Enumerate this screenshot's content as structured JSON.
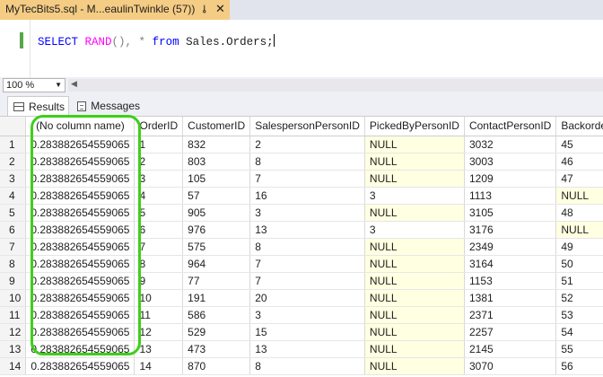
{
  "tab": {
    "title": "MyTecBits5.sql - M...eaulinTwinkle (57))",
    "pin": "⊸",
    "close": "✕"
  },
  "editor": {
    "kw_select": "SELECT",
    "fn_rand": "RAND",
    "rest1": "(), * ",
    "kw_from": "from",
    "rest2": " Sales.Orders;"
  },
  "zoom": {
    "value": "100 %"
  },
  "results_tabs": {
    "results": "Results",
    "messages": "Messages"
  },
  "grid": {
    "columns": [
      "(No column name)",
      "OrderID",
      "CustomerID",
      "SalespersonPersonID",
      "PickedByPersonID",
      "ContactPersonID",
      "BackorderOrd"
    ],
    "rows": [
      [
        "1",
        "0.283882654559065",
        "1",
        "832",
        "2",
        "NULL",
        "3032",
        "45"
      ],
      [
        "2",
        "0.283882654559065",
        "2",
        "803",
        "8",
        "NULL",
        "3003",
        "46"
      ],
      [
        "3",
        "0.283882654559065",
        "3",
        "105",
        "7",
        "NULL",
        "1209",
        "47"
      ],
      [
        "4",
        "0.283882654559065",
        "4",
        "57",
        "16",
        "3",
        "1113",
        "NULL"
      ],
      [
        "5",
        "0.283882654559065",
        "5",
        "905",
        "3",
        "NULL",
        "3105",
        "48"
      ],
      [
        "6",
        "0.283882654559065",
        "6",
        "976",
        "13",
        "3",
        "3176",
        "NULL"
      ],
      [
        "7",
        "0.283882654559065",
        "7",
        "575",
        "8",
        "NULL",
        "2349",
        "49"
      ],
      [
        "8",
        "0.283882654559065",
        "8",
        "964",
        "7",
        "NULL",
        "3164",
        "50"
      ],
      [
        "9",
        "0.283882654559065",
        "9",
        "77",
        "7",
        "NULL",
        "1153",
        "51"
      ],
      [
        "10",
        "0.283882654559065",
        "10",
        "191",
        "20",
        "NULL",
        "1381",
        "52"
      ],
      [
        "11",
        "0.283882654559065",
        "11",
        "586",
        "3",
        "NULL",
        "2371",
        "53"
      ],
      [
        "12",
        "0.283882654559065",
        "12",
        "529",
        "15",
        "NULL",
        "2257",
        "54"
      ],
      [
        "13",
        "0.283882654559065",
        "13",
        "473",
        "13",
        "NULL",
        "2145",
        "55"
      ],
      [
        "14",
        "0.283882654559065",
        "14",
        "870",
        "8",
        "NULL",
        "3070",
        "56"
      ]
    ]
  },
  "colors": {
    "tab_active": "#f5cc84",
    "highlight": "#3ecf1a",
    "null_bg": "#ffffe1",
    "keyword": "#0000ff",
    "function": "#ff00ff"
  }
}
